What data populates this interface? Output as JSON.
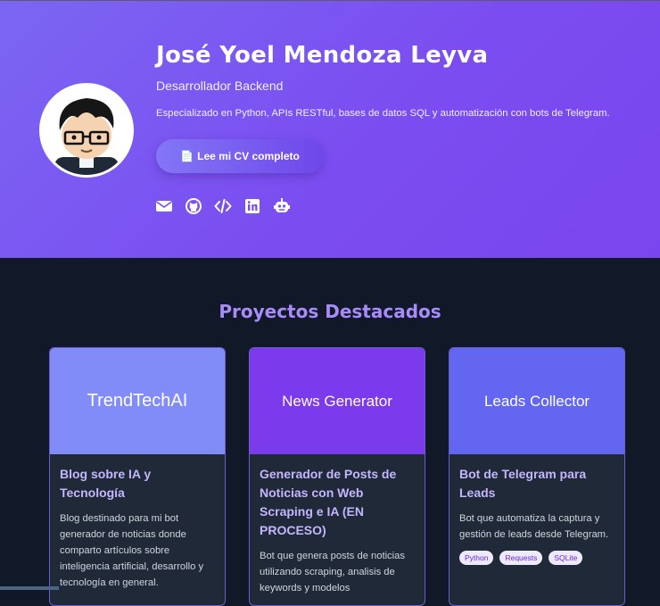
{
  "profile": {
    "name": "José Yoel Mendoza Leyva",
    "role": "Desarrollador Backend",
    "description": "Especializado en Python, APIs RESTful, bases de datos SQL y automatización con bots de Telegram.",
    "cv_button": "Lee mi CV completo",
    "cv_icon": "document-icon",
    "socials": [
      "email-icon",
      "github-icon",
      "code-icon",
      "linkedin-icon",
      "robot-icon"
    ]
  },
  "projects": {
    "title": "Proyectos Destacados",
    "cards": [
      {
        "thumb": "TrendTechAI",
        "thumb_color": "#818cf8",
        "title": "Blog sobre IA y Tecnología",
        "text": "Blog destinado para mi bot generador de noticias donde comparto artículos sobre inteligencia artificial, desarrollo y tecnología en general."
      },
      {
        "thumb": "News Generator",
        "thumb_color": "#7c3aed",
        "title": "Generador de Posts de Noticias con Web Scraping e IA (EN PROCESO)",
        "text": "Bot que genera posts de noticias utilizando scraping, analisis de keywords y modelos"
      },
      {
        "thumb": "Leads Collector",
        "thumb_color": "#6366f1",
        "title": "Bot de Telegram para Leads",
        "text": "Bot que automatiza la captura y gestión de leads desde Telegram.",
        "tags": [
          "Python",
          "Requests",
          "SQLite"
        ]
      }
    ]
  },
  "colors": {
    "accent": "#7b4df0",
    "heading": "#a78bfa",
    "background": "#111827",
    "card": "#1f2937"
  }
}
